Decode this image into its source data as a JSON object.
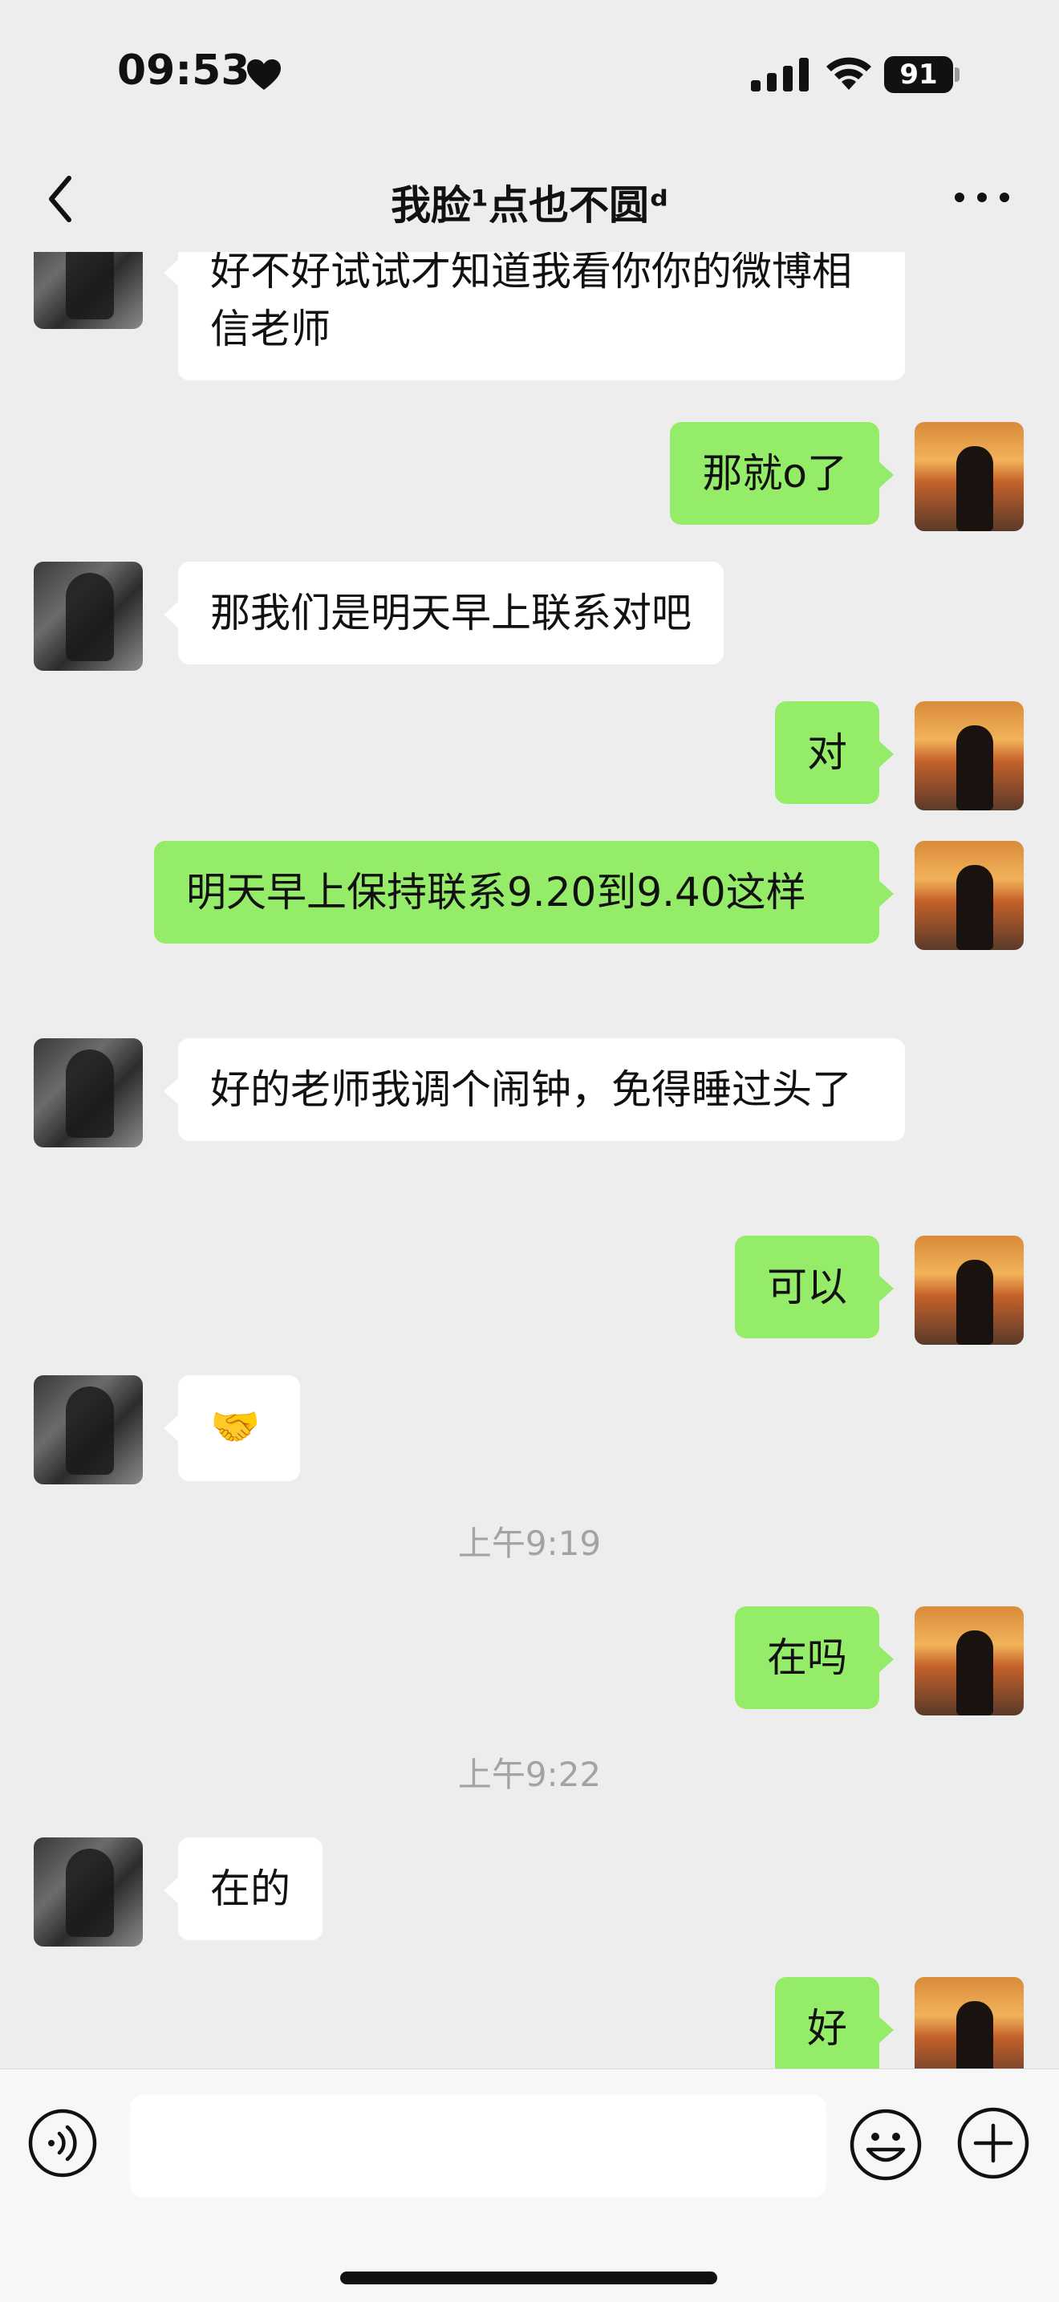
{
  "status_bar": {
    "time": "09:53",
    "battery": "91"
  },
  "nav": {
    "title": "我脸¹点也不圆ᵈ"
  },
  "messages": [
    {
      "side": "left",
      "text": "好不好试试才知道我看你你的微博相信老师"
    },
    {
      "side": "right",
      "text": "那就o了"
    },
    {
      "side": "left",
      "text": "那我们是明天早上联系对吧"
    },
    {
      "side": "right",
      "text": "对"
    },
    {
      "side": "right",
      "text": "明天早上保持联系9.20到9.40这样"
    },
    {
      "side": "left",
      "text": "好的老师我调个闹钟，免得睡过头了"
    },
    {
      "side": "right",
      "text": "可以"
    },
    {
      "side": "left",
      "text": "🤝"
    },
    {
      "side": "right",
      "text": "在吗"
    },
    {
      "side": "left",
      "text": "在的"
    },
    {
      "side": "right",
      "text": "好"
    }
  ],
  "timestamps": [
    "上午9:19",
    "上午9:22"
  ],
  "input": {
    "value": "",
    "placeholder": ""
  },
  "colors": {
    "background": "#ededed",
    "sent_bubble": "#95ec69",
    "received_bubble": "#ffffff"
  }
}
